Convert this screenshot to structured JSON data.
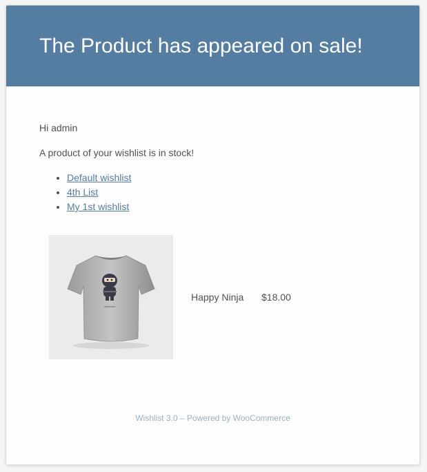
{
  "header": {
    "title": "The Product has appeared on sale!"
  },
  "body": {
    "greeting": "Hi admin",
    "intro": "A product of your wishlist is in stock!",
    "wishlists": [
      {
        "label": "Default wishlist"
      },
      {
        "label": "4th List"
      },
      {
        "label": "My 1st wishlist"
      }
    ]
  },
  "product": {
    "name": "Happy Ninja",
    "price": "$18.00",
    "image_icon": "ninja-tshirt-image"
  },
  "footer": {
    "text": "Wishlist 3.0 – Powered by WooCommerce"
  },
  "colors": {
    "header_bg": "#557da1",
    "link": "#557da1",
    "footer_text": "#99b1c7",
    "body_text": "#505050"
  }
}
